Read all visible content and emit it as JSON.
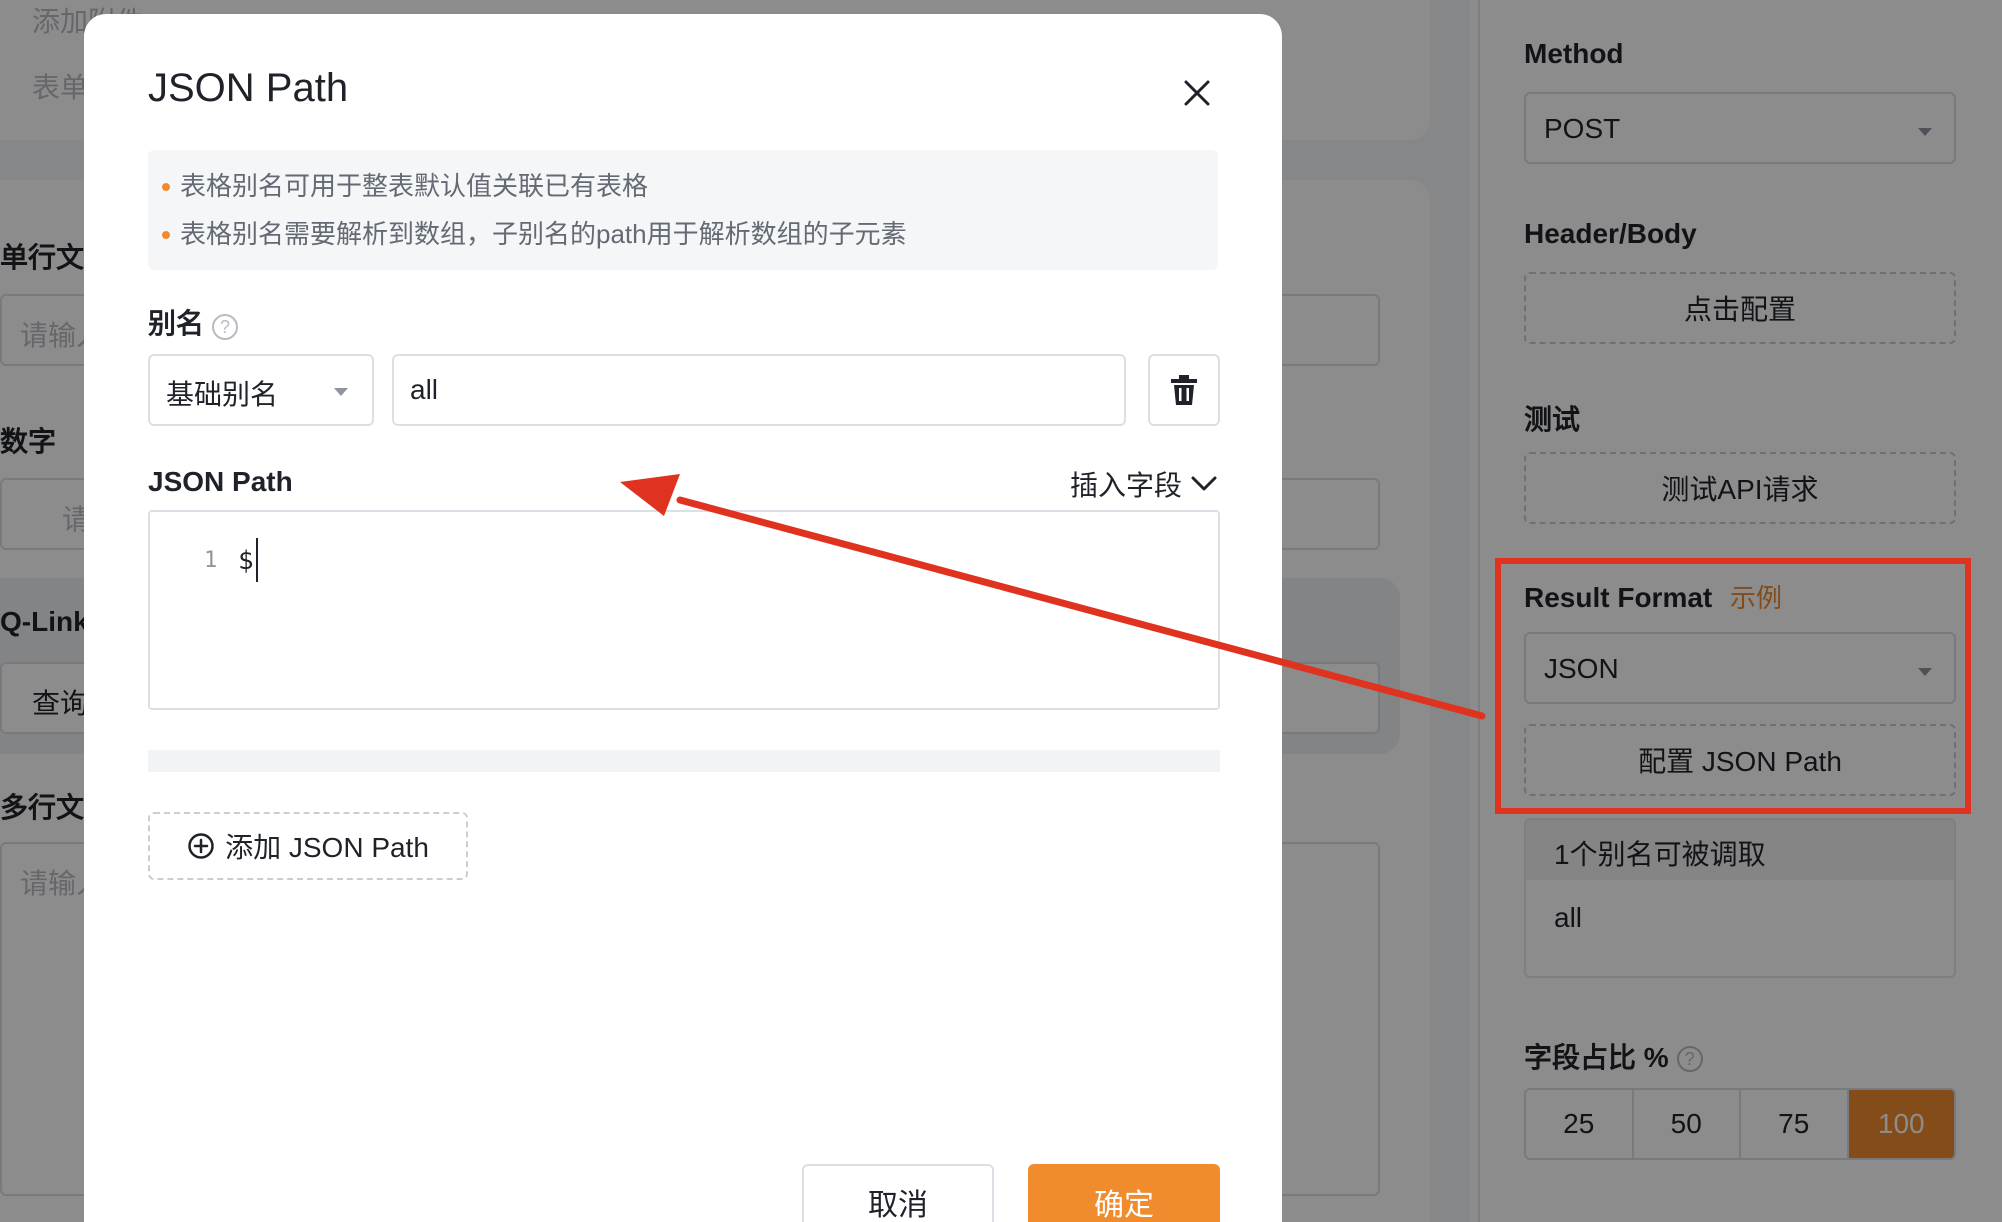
{
  "background": {
    "left": {
      "add_attachment": "添加附件",
      "form": "表单",
      "single_line_label": "单行文",
      "single_line_placeholder": "请输入",
      "number_label": "数字",
      "number_placeholder": "请",
      "qlink_label": "Q-Link",
      "qlink_value": "查询",
      "multiline_label": "多行文",
      "multiline_placeholder": "请输入"
    },
    "right": {
      "method_label": "Method",
      "method_value": "POST",
      "header_body_label": "Header/Body",
      "header_body_button": "点击配置",
      "test_label": "测试",
      "test_button": "测试API请求",
      "result_format_label": "Result Format",
      "result_format_example": "示例",
      "result_format_value": "JSON",
      "config_json_path_button": "配置 JSON Path",
      "alias_count_text": "1个别名可被调取",
      "alias_item": "all",
      "field_ratio_label": "字段占比 %",
      "ratio_options": [
        "25",
        "50",
        "75",
        "100"
      ],
      "ratio_selected": "100"
    }
  },
  "modal": {
    "title": "JSON Path",
    "tips": [
      "表格别名可用于整表默认值关联已有表格",
      "表格别名需要解析到数组，子别名的path用于解析数组的子元素"
    ],
    "alias_label": "别名",
    "alias_type_value": "基础别名",
    "alias_input_value": "all",
    "json_path_label": "JSON Path",
    "insert_field_label": "插入字段",
    "editor": {
      "line_number": "1",
      "code": "$"
    },
    "add_json_path_label": "添加 JSON Path",
    "cancel_label": "取消",
    "confirm_label": "确定"
  },
  "colors": {
    "accent": "#f08b2e",
    "annotation_red": "#e0331f",
    "overlay": "rgba(0,0,0,0.45)"
  },
  "icons": [
    "close-icon",
    "help-icon",
    "trash-icon",
    "chevron-down-icon",
    "plus-circle-icon",
    "caret-down-icon"
  ]
}
